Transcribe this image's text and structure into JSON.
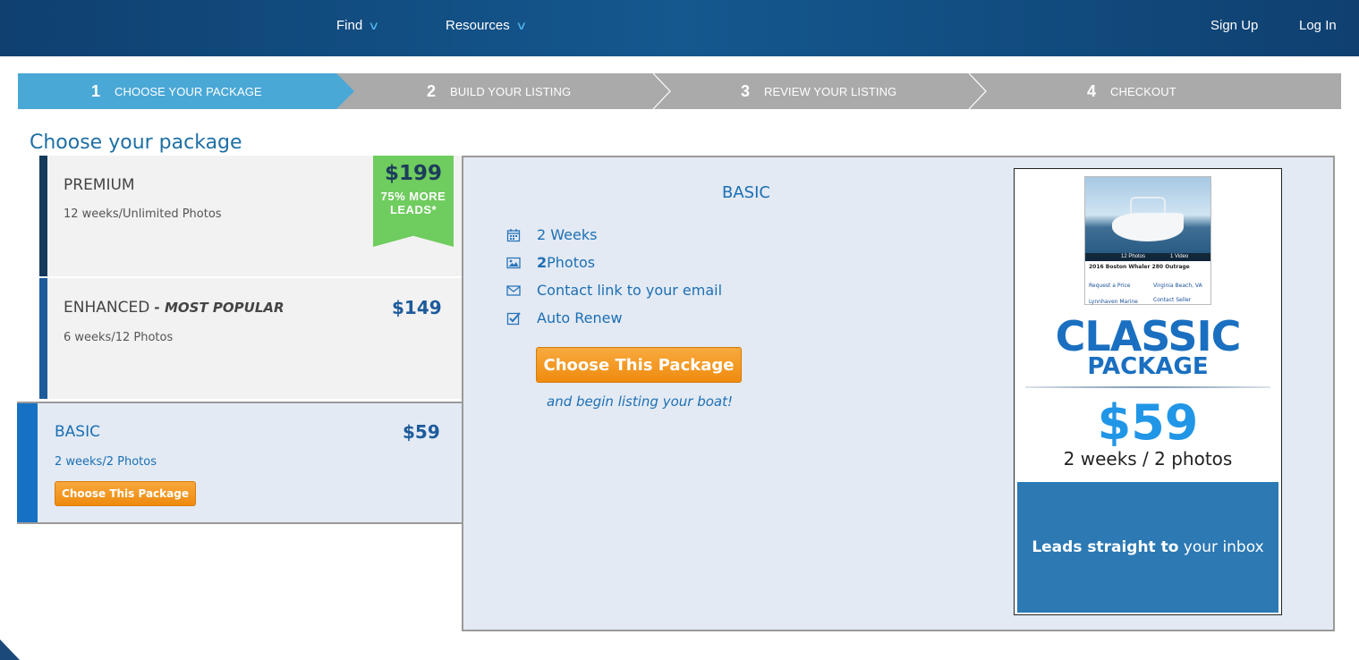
{
  "nav": {
    "find": "Find",
    "resources": "Resources",
    "sign_up": "Sign Up",
    "log_in": "Log In"
  },
  "steps": [
    {
      "num": "1",
      "label": "CHOOSE YOUR PACKAGE",
      "active": true
    },
    {
      "num": "2",
      "label": "BUILD YOUR LISTING",
      "active": false
    },
    {
      "num": "3",
      "label": "REVIEW YOUR LISTING",
      "active": false
    },
    {
      "num": "4",
      "label": "CHECKOUT",
      "active": false
    }
  ],
  "page_title": "Choose your package",
  "packages": {
    "premium": {
      "name": "PREMIUM",
      "desc": "12 weeks/Unlimited Photos",
      "price": "$199",
      "ribbon_text": "75% MORE LEADS*"
    },
    "enhanced": {
      "name": "ENHANCED",
      "tag": " - MOST POPULAR",
      "desc": "6 weeks/12 Photos",
      "price": "$149"
    },
    "basic": {
      "name": "BASIC",
      "desc": "2 weeks/2 Photos",
      "price": "$59",
      "button": "Choose This Package"
    }
  },
  "detail": {
    "title": "BASIC",
    "features": [
      {
        "icon": "calendar-icon",
        "text": "2 Weeks"
      },
      {
        "icon": "image-icon",
        "bold": "2",
        "text": " Photos"
      },
      {
        "icon": "envelope-icon",
        "text": "Contact link to your email"
      },
      {
        "icon": "check-square-icon",
        "text": "Auto Renew"
      }
    ],
    "button": "Choose This Package",
    "subtext": "and begin listing your boat!"
  },
  "ad": {
    "photo_caption": "2016 Boston Whaler 280 Outrage",
    "photos_label": "12 Photos",
    "video_label": "1 Video",
    "price_label": "Request a Price",
    "location": "Virginia Beach, VA",
    "seller": "Lynnhaven Marine",
    "contact": "Contact Seller",
    "classic": "CLASSIC",
    "package": "PACKAGE",
    "price": "$59",
    "weeks": "2 weeks / 2 photos",
    "leads_bold": "Leads straight to",
    "leads_rest": " your inbox"
  },
  "colors": {
    "nav_bg": "#14588f",
    "active_step": "#4aa8d6",
    "inactive_step": "#aaaaaa",
    "accent_blue": "#1d6fb3",
    "ribbon_green": "#6fcc5e",
    "button_orange": "#ef8b0f"
  }
}
